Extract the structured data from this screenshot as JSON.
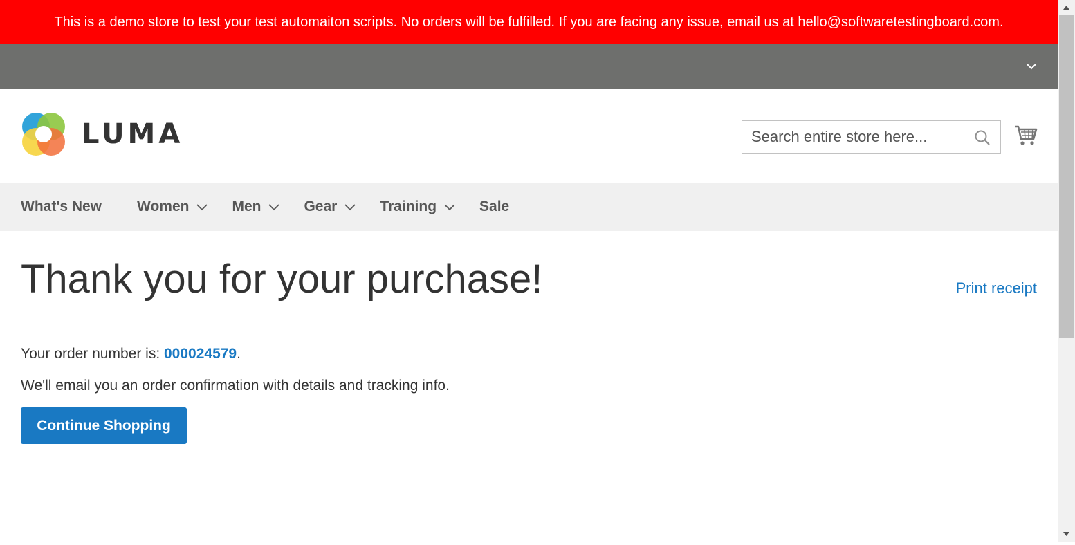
{
  "banner": {
    "text": "This is a demo store to test your test automaiton scripts. No orders will be fulfilled. If you are facing any issue, email us at hello@softwaretestingboard.com."
  },
  "header": {
    "logo_text": "LUMA",
    "search": {
      "placeholder": "Search entire store here..."
    }
  },
  "nav": {
    "items": [
      {
        "label": "What's New"
      },
      {
        "label": "Women"
      },
      {
        "label": "Men"
      },
      {
        "label": "Gear"
      },
      {
        "label": "Training"
      },
      {
        "label": "Sale"
      }
    ]
  },
  "main": {
    "title": "Thank you for your purchase!",
    "print_receipt": "Print receipt",
    "order_prefix": "Your order number is: ",
    "order_number": "000024579",
    "order_suffix": ".",
    "email_note": "We'll email you an order confirmation with details and tracking info.",
    "continue_label": "Continue Shopping"
  },
  "colors": {
    "banner_bg": "#ff0000",
    "topbar_bg": "#6e6f6d",
    "nav_bg": "#f0f0f0",
    "link": "#1979c3",
    "primary_button": "#1979c3"
  },
  "icons": {
    "topbar_toggle": "chevron-down-icon",
    "search": "search-icon",
    "cart": "cart-icon",
    "nav_dropdown": "chevron-down-icon"
  }
}
